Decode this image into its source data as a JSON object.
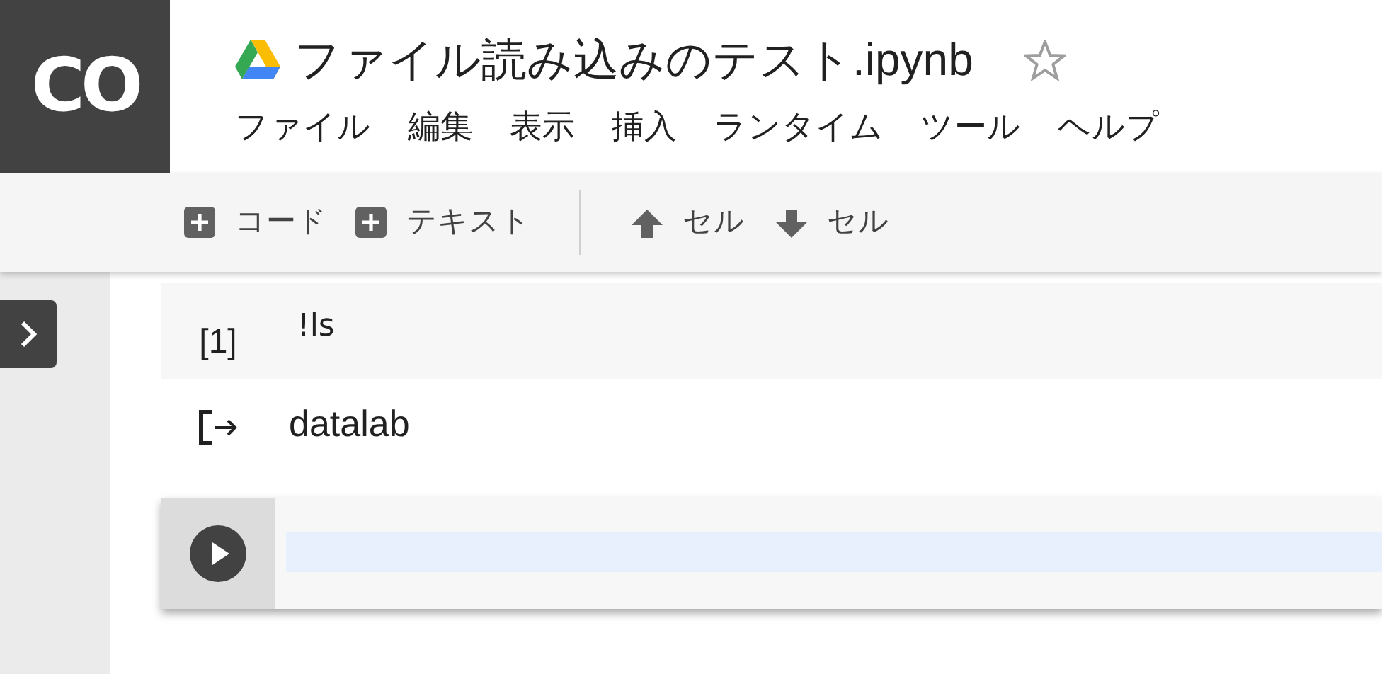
{
  "logo": "CO",
  "title": "ファイル読み込みのテスト.ipynb",
  "starred": false,
  "menu": [
    "ファイル",
    "編集",
    "表示",
    "挿入",
    "ランタイム",
    "ツール",
    "ヘルプ"
  ],
  "toolbar": {
    "insert": [
      {
        "label": "コード"
      },
      {
        "label": "テキスト"
      }
    ],
    "move": [
      {
        "label": "セル",
        "kind": "up"
      },
      {
        "label": "セル",
        "kind": "down"
      }
    ]
  },
  "cells": [
    {
      "kind": "code",
      "focused": false,
      "count": "[1]",
      "source": "!ls",
      "output": "datalab"
    },
    {
      "kind": "empty",
      "focused": true
    }
  ]
}
